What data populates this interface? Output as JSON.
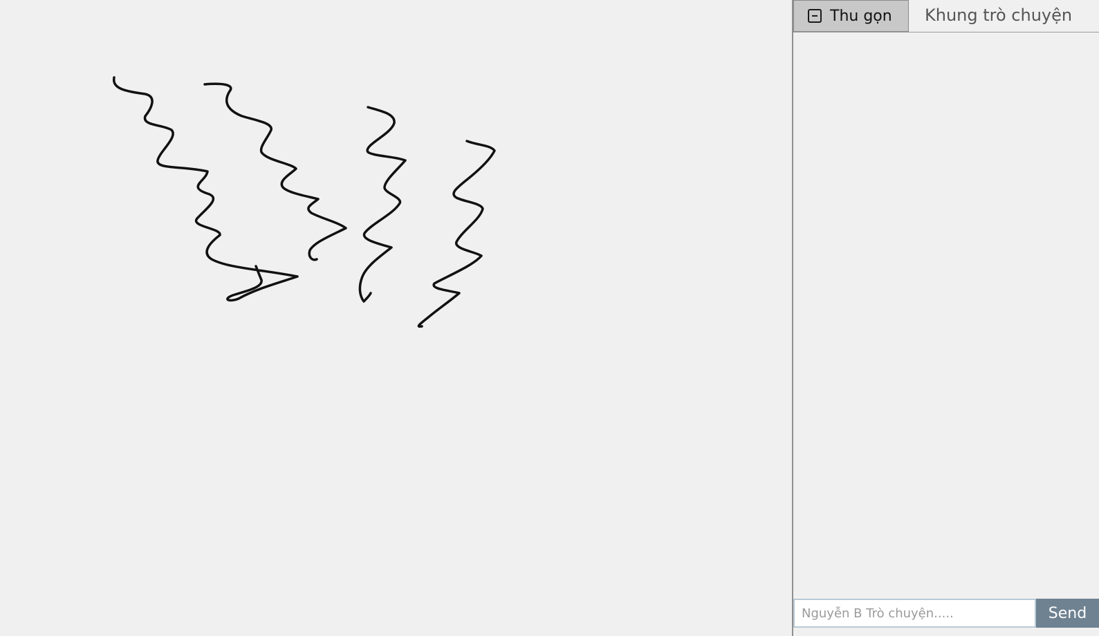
{
  "chat": {
    "collapse_label": "Thu gọn",
    "collapse_icon": "collapse-square-icon",
    "title": "Khung trò chuyện",
    "input_placeholder": "Nguyễn B Trò chuyện.....",
    "input_value": "",
    "send_label": "Send"
  },
  "canvas": {
    "stroke_color": "#111111",
    "stroke_count": 4
  }
}
